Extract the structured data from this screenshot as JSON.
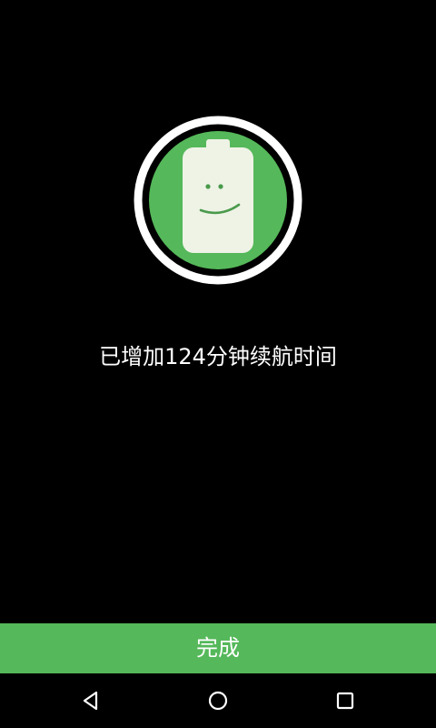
{
  "icons": {
    "battery": "battery-smile-icon",
    "back": "back-triangle-icon",
    "home": "home-circle-icon",
    "recent": "recent-square-icon"
  },
  "colors": {
    "background": "#000000",
    "accent_green": "#55b85a",
    "battery_body": "#eef3e6",
    "text": "#ffffff"
  },
  "result": {
    "message": "已增加124分钟续航时间"
  },
  "actions": {
    "done_label": "完成"
  }
}
